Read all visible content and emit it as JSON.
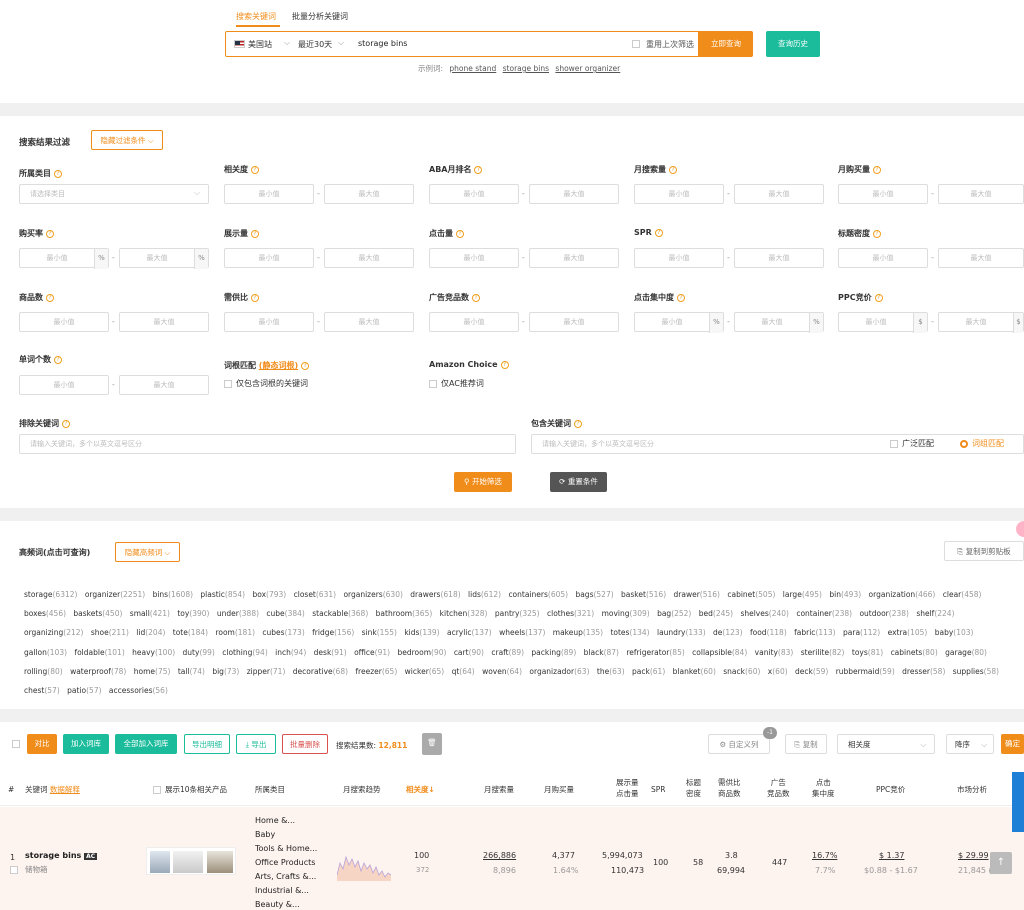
{
  "search": {
    "tab_active": "搜索关键词",
    "tab_batch": "批量分析关键词",
    "site": "美国站",
    "period": "最近30天",
    "keyword": "storage bins",
    "reuse_label": "重用上次筛选",
    "search_button": "立即查询",
    "history_button": "查询历史",
    "examples_label": "示例词:",
    "examples": [
      "phone stand",
      "storage bins",
      "shower organizer"
    ]
  },
  "filter": {
    "title": "搜索结果过滤",
    "hide_button": "隐藏过滤条件",
    "min": "最小值",
    "max": "最大值",
    "category_label": "所属类目",
    "category_placeholder": "请选择类目",
    "relevance": "相关度",
    "aba_rank": "ABA月排名",
    "monthly_search": "月搜索量",
    "monthly_purchase": "月购买量",
    "purchase_rate": "购买率",
    "impressions": "展示量",
    "clicks": "点击量",
    "spr": "SPR",
    "title_density": "标题密度",
    "product_count": "商品数",
    "supply_demand": "需供比",
    "ad_products": "广告竞品数",
    "click_concentration": "点击集中度",
    "ppc_bid": "PPC竞价",
    "word_count": "单词个数",
    "root_match_label": "词根匹配",
    "root_match_note": "(静态词根)",
    "root_only": "仅包含词根的关键词",
    "amazon_choice": "Amazon Choice",
    "ac_only": "仅AC推荐词",
    "exclude_label": "排除关键词",
    "exclude_placeholder": "请输入关键词，多个以英文逗号区分",
    "include_label": "包含关键词",
    "include_placeholder": "请输入关键词，多个以英文逗号区分",
    "broad_match": "广泛匹配",
    "root_match": "词组匹配",
    "start_button": "开始筛选",
    "reset_button": "重置条件",
    "percent": "%",
    "dollar": "$"
  },
  "freq": {
    "title": "高频词(点击可查询)",
    "hide_button": "隐藏高频词",
    "copy_button": "复制到剪贴板",
    "words": [
      [
        "storage",
        "6312"
      ],
      [
        "organizer",
        "2251"
      ],
      [
        "bins",
        "1608"
      ],
      [
        "plastic",
        "854"
      ],
      [
        "box",
        "793"
      ],
      [
        "closet",
        "631"
      ],
      [
        "organizers",
        "630"
      ],
      [
        "drawers",
        "618"
      ],
      [
        "lids",
        "612"
      ],
      [
        "containers",
        "605"
      ],
      [
        "bags",
        "527"
      ],
      [
        "basket",
        "516"
      ],
      [
        "drawer",
        "516"
      ],
      [
        "cabinet",
        "505"
      ],
      [
        "large",
        "495"
      ],
      [
        "bin",
        "493"
      ],
      [
        "organization",
        "466"
      ],
      [
        "clear",
        "458"
      ],
      [
        "boxes",
        "456"
      ],
      [
        "baskets",
        "450"
      ],
      [
        "small",
        "421"
      ],
      [
        "toy",
        "390"
      ],
      [
        "under",
        "388"
      ],
      [
        "cube",
        "384"
      ],
      [
        "stackable",
        "368"
      ],
      [
        "bathroom",
        "365"
      ],
      [
        "kitchen",
        "328"
      ],
      [
        "pantry",
        "325"
      ],
      [
        "clothes",
        "321"
      ],
      [
        "moving",
        "309"
      ],
      [
        "bag",
        "252"
      ],
      [
        "bed",
        "245"
      ],
      [
        "shelves",
        "240"
      ],
      [
        "container",
        "238"
      ],
      [
        "outdoor",
        "238"
      ],
      [
        "shelf",
        "224"
      ],
      [
        "organizing",
        "212"
      ],
      [
        "shoe",
        "211"
      ],
      [
        "lid",
        "204"
      ],
      [
        "tote",
        "184"
      ],
      [
        "room",
        "181"
      ],
      [
        "cubes",
        "173"
      ],
      [
        "fridge",
        "156"
      ],
      [
        "sink",
        "155"
      ],
      [
        "kids",
        "139"
      ],
      [
        "acrylic",
        "137"
      ],
      [
        "wheels",
        "137"
      ],
      [
        "makeup",
        "135"
      ],
      [
        "totes",
        "134"
      ],
      [
        "laundry",
        "133"
      ],
      [
        "de",
        "123"
      ],
      [
        "food",
        "118"
      ],
      [
        "fabric",
        "113"
      ],
      [
        "para",
        "112"
      ],
      [
        "extra",
        "105"
      ],
      [
        "baby",
        "103"
      ],
      [
        "gallon",
        "103"
      ],
      [
        "foldable",
        "101"
      ],
      [
        "heavy",
        "100"
      ],
      [
        "duty",
        "99"
      ],
      [
        "clothing",
        "94"
      ],
      [
        "inch",
        "94"
      ],
      [
        "desk",
        "91"
      ],
      [
        "office",
        "91"
      ],
      [
        "bedroom",
        "90"
      ],
      [
        "cart",
        "90"
      ],
      [
        "craft",
        "89"
      ],
      [
        "packing",
        "89"
      ],
      [
        "black",
        "87"
      ],
      [
        "refrigerator",
        "85"
      ],
      [
        "collapsible",
        "84"
      ],
      [
        "vanity",
        "83"
      ],
      [
        "sterilite",
        "82"
      ],
      [
        "toys",
        "81"
      ],
      [
        "cabinets",
        "80"
      ],
      [
        "garage",
        "80"
      ],
      [
        "rolling",
        "80"
      ],
      [
        "waterproof",
        "78"
      ],
      [
        "home",
        "75"
      ],
      [
        "tall",
        "74"
      ],
      [
        "big",
        "73"
      ],
      [
        "zipper",
        "71"
      ],
      [
        "decorative",
        "68"
      ],
      [
        "freezer",
        "65"
      ],
      [
        "wicker",
        "65"
      ],
      [
        "qt",
        "64"
      ],
      [
        "woven",
        "64"
      ],
      [
        "organizador",
        "63"
      ],
      [
        "the",
        "63"
      ],
      [
        "pack",
        "61"
      ],
      [
        "blanket",
        "60"
      ],
      [
        "snack",
        "60"
      ],
      [
        "x",
        "60"
      ],
      [
        "deck",
        "59"
      ],
      [
        "rubbermaid",
        "59"
      ],
      [
        "dresser",
        "58"
      ],
      [
        "supplies",
        "58"
      ],
      [
        "chest",
        "57"
      ],
      [
        "patio",
        "57"
      ],
      [
        "accessories",
        "56"
      ]
    ]
  },
  "toolbar": {
    "compare": "对比",
    "add_lib": "加入词库",
    "add_all": "全部加入词库",
    "export_detail": "导出明细",
    "export": "导出",
    "batch_delete": "批量删除",
    "result_label": "搜索结果数:",
    "result_count": "12,811",
    "custom_cols": "自定义列",
    "custom_badge": "-1",
    "copy": "复制",
    "sort_field": "相关度",
    "sort_order": "降序",
    "confirm": "确定"
  },
  "table": {
    "headers": {
      "index": "#",
      "keyword": "关键词",
      "keyword_note": "数据解释",
      "show_products": "展示10条相关产品",
      "category": "所属类目",
      "trend": "月搜索趋势",
      "relevance": "相关度↓",
      "monthly_search": "月搜索量",
      "monthly_purchase": "月购买量",
      "imp_line1": "展示量",
      "imp_line2": "点击量",
      "spr": "SPR",
      "td_line1": "标题",
      "td_line2": "密度",
      "sd_line1": "需供比",
      "sd_line2": "商品数",
      "ad_line1": "广告",
      "ad_line2": "竞品数",
      "cc_line1": "点击",
      "cc_line2": "集中度",
      "ppc": "PPC竞价",
      "market": "市场分析"
    },
    "row": {
      "index": "1",
      "keyword": "storage bins",
      "ac_badge": "AC",
      "translation": "储物箱",
      "categories": [
        "Home &...",
        "Baby",
        "Tools & Home...",
        "Office Products",
        "Arts, Crafts &...",
        "Industrial &...",
        "Beauty &..."
      ],
      "relevance": "100",
      "relevance_sub": "372",
      "monthly_search": "266,886",
      "monthly_search_sub": "8,896",
      "monthly_purchase": "4,377",
      "monthly_purchase_sub": "1.64%",
      "impressions": "5,994,073",
      "clicks": "110,473",
      "spr": "100",
      "title_density": "58",
      "supply_demand": "3.8",
      "product_count": "69,994",
      "ad_products": "447",
      "click_concentration": "16.7%",
      "click_concentration_sub": "7.7%",
      "ppc": "$ 1.37",
      "ppc_range": "$0.88 - $1.67",
      "market_price": "$ 29.99",
      "market_sub": "21,845 (4."
    }
  }
}
